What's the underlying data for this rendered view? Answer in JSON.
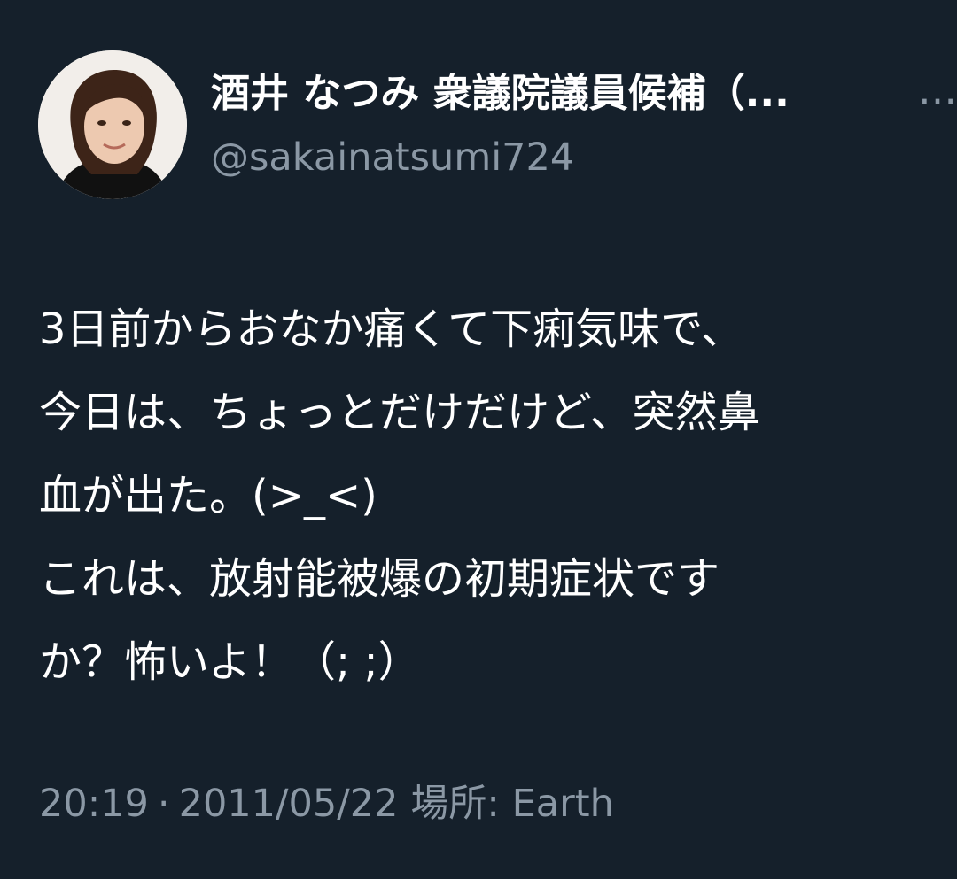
{
  "tweet": {
    "author": {
      "display_name": "酒井 なつみ 衆議院議員候補（...",
      "handle": "@sakainatsumi724",
      "avatar_icon": "profile-photo"
    },
    "more_icon": "more-options-icon",
    "more_label": "…",
    "text_lines": [
      "3日前からおなか痛くて下痢気味で、",
      "今日は、ちょっとだけだけど、突然鼻",
      "血が出た。(>_<)",
      "これは、放射能被爆の初期症状です",
      "か？怖いよ！（; ;）"
    ],
    "time": "20:19",
    "separator": "·",
    "date": "2011/05/22",
    "location_label": "場所:",
    "location": "Earth"
  },
  "colors": {
    "background": "#15202b",
    "primary_text": "#ffffff",
    "secondary_text": "#8b98a5"
  }
}
